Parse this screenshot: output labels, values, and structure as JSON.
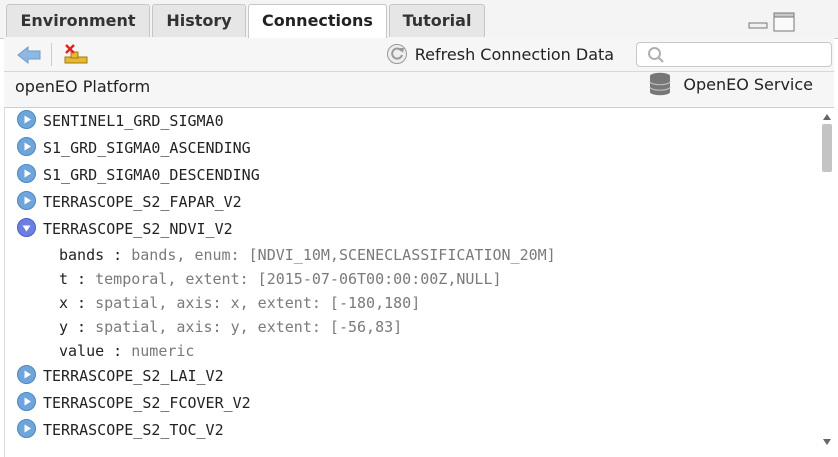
{
  "tabs": [
    {
      "label": "Environment",
      "active": false
    },
    {
      "label": "History",
      "active": false
    },
    {
      "label": "Connections",
      "active": true
    },
    {
      "label": "Tutorial",
      "active": false
    }
  ],
  "toolbar": {
    "refresh_label": "Refresh Connection Data",
    "search_placeholder": ""
  },
  "connection": {
    "name": "openEO Platform",
    "service_label": "OpenEO Service"
  },
  "collections": [
    {
      "name": "SENTINEL1_GRD_SIGMA0",
      "expanded": false
    },
    {
      "name": "S1_GRD_SIGMA0_ASCENDING",
      "expanded": false
    },
    {
      "name": "S1_GRD_SIGMA0_DESCENDING",
      "expanded": false
    },
    {
      "name": "TERRASCOPE_S2_FAPAR_V2",
      "expanded": false
    },
    {
      "name": "TERRASCOPE_S2_NDVI_V2",
      "expanded": true
    },
    {
      "name": "TERRASCOPE_S2_LAI_V2",
      "expanded": false
    },
    {
      "name": "TERRASCOPE_S2_FCOVER_V2",
      "expanded": false
    },
    {
      "name": "TERRASCOPE_S2_TOC_V2",
      "expanded": false
    }
  ],
  "dimensions": [
    {
      "key": "bands",
      "sep": " : ",
      "value": "bands, enum: [NDVI_10M,SCENECLASSIFICATION_20M]"
    },
    {
      "key": "t",
      "sep": " : ",
      "value": "temporal, extent: [2015-07-06T00:00:00Z,NULL]"
    },
    {
      "key": "x",
      "sep": " : ",
      "value": "spatial, axis: x, extent: [-180,180]"
    },
    {
      "key": "y",
      "sep": " : ",
      "value": "spatial, axis: y, extent: [-56,83]"
    },
    {
      "key": "value",
      "sep": " : ",
      "value": "numeric"
    }
  ],
  "colors": {
    "accent_blue": "#4a90d9",
    "expanded_purple": "#5b6fd6",
    "muted_text": "#7a7a7a"
  }
}
